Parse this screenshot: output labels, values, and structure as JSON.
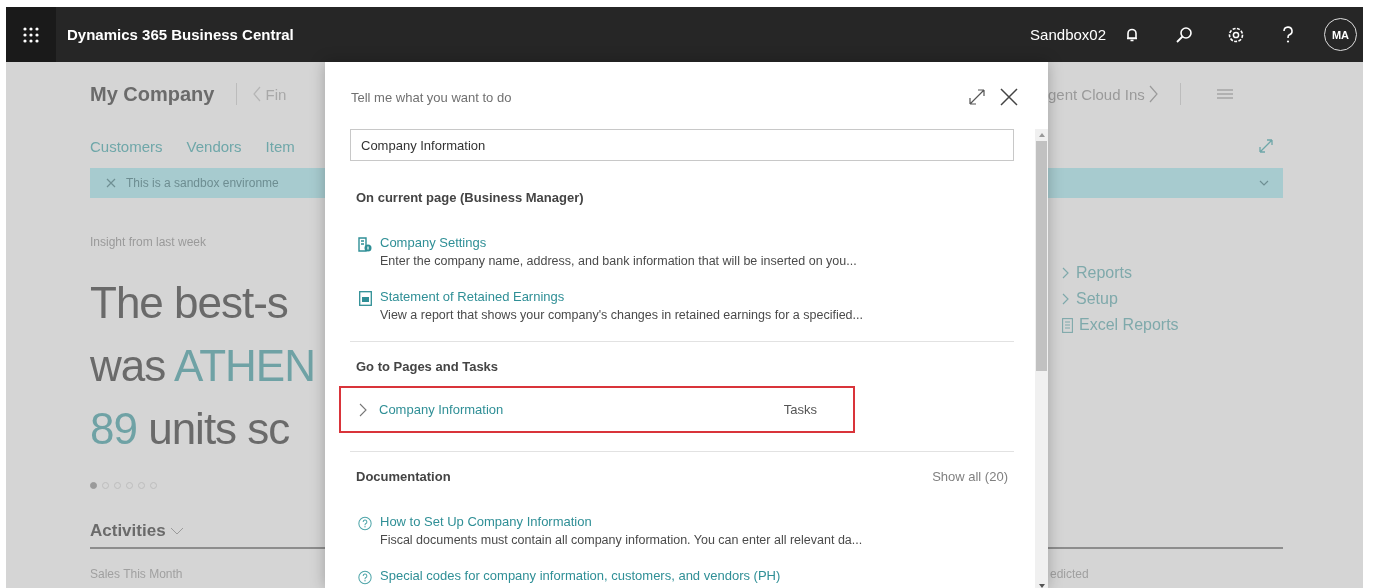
{
  "top_bar": {
    "title": "Dynamics 365 Business Central",
    "environment": "Sandbox02",
    "avatar": "MA"
  },
  "background_page": {
    "company": "My Company",
    "nav_left": "Fin",
    "nav_right": "gent Cloud Ins",
    "links": [
      "Customers",
      "Vendors",
      "Item"
    ],
    "banner": "This is a sandbox environme",
    "insight_caption": "Insight from last week",
    "headline_lines": [
      [
        {
          "text": "The best-s",
          "accent": false
        }
      ],
      [
        {
          "text": "was ",
          "accent": false
        },
        {
          "text": "ATHEN",
          "accent": true
        }
      ],
      [
        {
          "text": "89",
          "accent": true
        },
        {
          "text": " units sc",
          "accent": false
        }
      ]
    ],
    "carousel_dots": [
      {
        "selected": true
      },
      {
        "selected": false
      },
      {
        "selected": false
      },
      {
        "selected": false
      },
      {
        "selected": false
      },
      {
        "selected": false
      }
    ],
    "activities": "Activities",
    "sales_label": "Sales This Month",
    "right_links": [
      {
        "kind": "group",
        "label": "Reports"
      },
      {
        "kind": "group",
        "label": "Setup"
      },
      {
        "kind": "report",
        "label": "Excel Reports"
      }
    ],
    "right_label": "edicted"
  },
  "dialog": {
    "title": "Tell me what you want to do",
    "search": {
      "value": "Company Information"
    },
    "sections": [
      {
        "title": "On current page (Business Manager)",
        "items": [
          {
            "kind": "page",
            "title": "Company Settings",
            "description": "Enter the company name, address, and bank information that will be inserted on you..."
          },
          {
            "kind": "report",
            "title": "Statement of Retained Earnings",
            "description": "View a report that shows your company's changes in retained earnings for a specified..."
          }
        ]
      },
      {
        "title": "Go to Pages and Tasks",
        "items": [
          {
            "kind": "task",
            "title": "Company Information",
            "category": "Tasks",
            "highlighted": true
          }
        ]
      },
      {
        "title": "Documentation",
        "action": "Show all (20)",
        "items": [
          {
            "kind": "help",
            "title": "How to Set Up Company Information",
            "description": "Fiscal documents must contain all company information. You can enter all relevant da..."
          },
          {
            "kind": "help",
            "title": "Special codes for company information, customers, and vendors (PH)"
          }
        ]
      }
    ]
  }
}
